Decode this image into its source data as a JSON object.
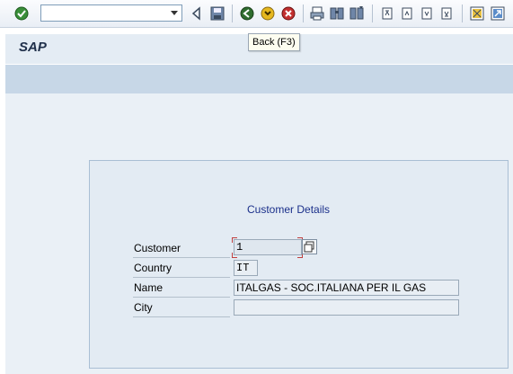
{
  "toolbar": {
    "command_value": "",
    "icons": [
      "enter-check-icon",
      "back-triangle-icon",
      "save-icon",
      "back-icon",
      "exit-icon",
      "cancel-icon",
      "print-icon",
      "find-icon",
      "find-next-icon",
      "first-page-icon",
      "previous-page-icon",
      "next-page-icon",
      "last-page-icon",
      "create-session-icon",
      "shortcut-icon"
    ],
    "tooltip": "Back  (F3)"
  },
  "title": "SAP",
  "panel": {
    "title": "Customer Details",
    "fields": [
      {
        "label": "Customer",
        "value": "1"
      },
      {
        "label": "Country",
        "value": "IT"
      },
      {
        "label": "Name",
        "value": "ITALGAS - SOC.ITALIANA PER IL GAS"
      },
      {
        "label": "City",
        "value": ""
      }
    ]
  },
  "colors": {
    "title_bar": "#e4ecf4",
    "app_bar": "#c7d7e7",
    "work_area": "#eaf0f6",
    "panel_title": "#1a2f8a",
    "required_marker": "#c04040"
  }
}
